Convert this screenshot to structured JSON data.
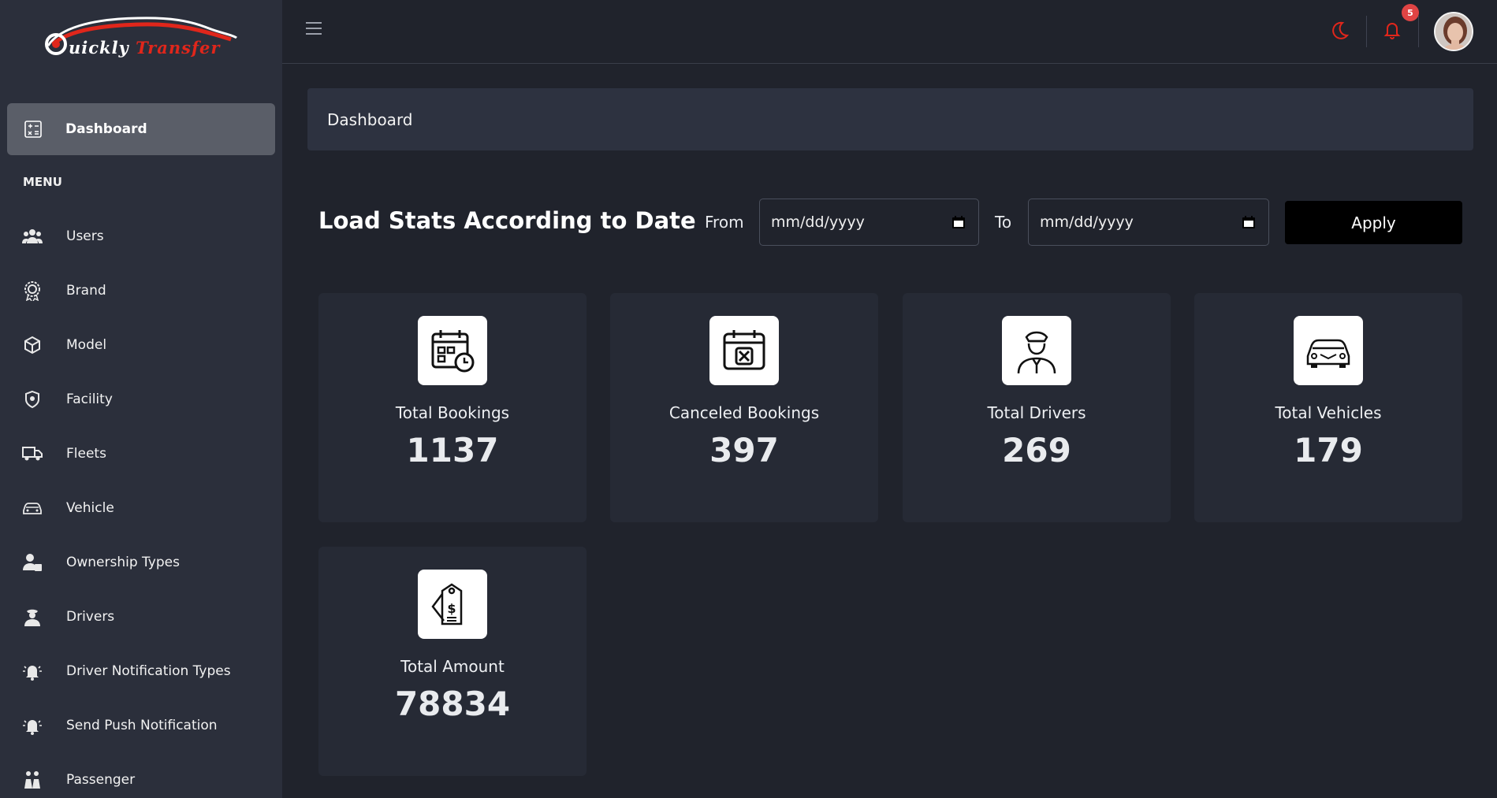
{
  "logo": {
    "text_white": "uickly",
    "text_red": "Transfer"
  },
  "sidebar": {
    "dashboard_label": "Dashboard",
    "menu_heading": "MENU",
    "items": [
      {
        "label": "Users",
        "icon": "users-icon"
      },
      {
        "label": "Brand",
        "icon": "brand-badge-icon"
      },
      {
        "label": "Model",
        "icon": "model-cube-icon"
      },
      {
        "label": "Facility",
        "icon": "facility-shield-icon"
      },
      {
        "label": "Fleets",
        "icon": "fleets-truck-icon"
      },
      {
        "label": "Vehicle",
        "icon": "vehicle-car-icon"
      },
      {
        "label": "Ownership Types",
        "icon": "ownership-user-icon"
      },
      {
        "label": "Drivers",
        "icon": "driver-icon"
      },
      {
        "label": "Driver Notification Types",
        "icon": "alarm-bell-icon"
      },
      {
        "label": "Send Push Notification",
        "icon": "push-bell-icon"
      },
      {
        "label": "Passenger",
        "icon": "passenger-icon"
      }
    ]
  },
  "header": {
    "notification_count": "5",
    "accent_color": "#e0261b"
  },
  "breadcrumb": {
    "title": "Dashboard"
  },
  "filter": {
    "title": "Load Stats According to Date",
    "from_label": "From",
    "to_label": "To",
    "from_placeholder": "mm/dd/yyyy",
    "to_placeholder": "mm/dd/yyyy",
    "apply_label": "Apply"
  },
  "stats": [
    {
      "label": "Total Bookings",
      "value": "1137",
      "icon": "calendar-clock-icon"
    },
    {
      "label": "Canceled Bookings",
      "value": "397",
      "icon": "calendar-cancel-icon"
    },
    {
      "label": "Total Drivers",
      "value": "269",
      "icon": "driver-cap-icon"
    },
    {
      "label": "Total Vehicles",
      "value": "179",
      "icon": "car-front-icon"
    },
    {
      "label": "Total Amount",
      "value": "78834",
      "icon": "price-tag-icon"
    }
  ]
}
